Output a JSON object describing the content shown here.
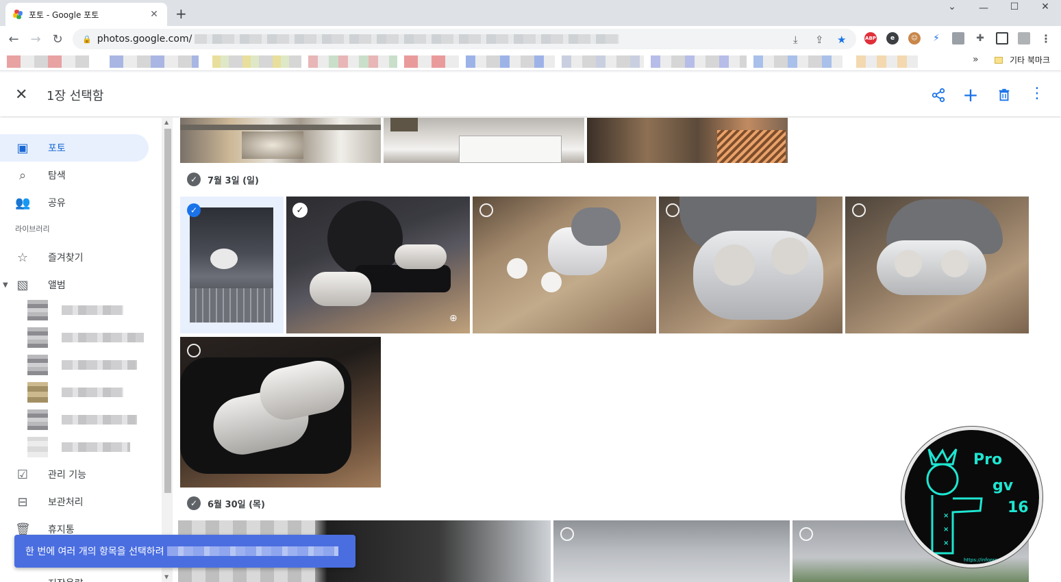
{
  "browser": {
    "tab_title": "포토 - Google 포토",
    "tab_close": "✕",
    "new_tab": "+",
    "window_controls": {
      "minimize": "—",
      "maximize": "☐",
      "close": "✕"
    },
    "url": "photos.google.com/",
    "bookmarks_overflow": "»",
    "other_bookmarks": "기타 북마크",
    "extensions": [
      {
        "name": "abp-icon",
        "text": "ABP",
        "color": "#e0303a"
      },
      {
        "name": "e-icon",
        "text": "e",
        "color": "#3c4043"
      },
      {
        "name": "face-icon",
        "text": "☺",
        "color": "#c8874b"
      },
      {
        "name": "bolt-icon",
        "text": "⚡",
        "color": "#ffffff"
      },
      {
        "name": "profile-ext-icon",
        "text": "",
        "color": "#9aa0a6"
      },
      {
        "name": "puzzle-icon",
        "text": "✚",
        "color": "#ffffff"
      }
    ]
  },
  "header": {
    "close_icon": "✕",
    "selection_title": "1장 선택함",
    "actions": {
      "share": "share-icon",
      "add": "+",
      "delete": "trash-icon",
      "more": "⋮"
    }
  },
  "sidebar": {
    "items": [
      {
        "label": "포토",
        "icon": "photo-icon",
        "active": true
      },
      {
        "label": "탐색",
        "icon": "search-icon"
      },
      {
        "label": "공유",
        "icon": "people-icon"
      }
    ],
    "library_label": "라이브러리",
    "library_items": [
      {
        "label": "즐겨찾기",
        "icon": "star-icon"
      },
      {
        "label": "앨범",
        "icon": "album-icon"
      }
    ],
    "tools": [
      {
        "label": "관리 기능",
        "icon": "utilities-icon"
      },
      {
        "label": "보관처리",
        "icon": "archive-icon"
      },
      {
        "label": "휴지통",
        "icon": "trash-icon"
      }
    ],
    "storage_label": "저장용량"
  },
  "content": {
    "groups": [
      {
        "date": "7월 3일 (일)"
      },
      {
        "date": "6월 30일 (목)"
      }
    ]
  },
  "toast": {
    "text": "한 번에 여러 개의 항목을 선택하려"
  },
  "watermark": {
    "line1": "Pro",
    "line2": "gv",
    "line3": "16",
    "url": "https://infoprogrammer.tistory.com"
  }
}
